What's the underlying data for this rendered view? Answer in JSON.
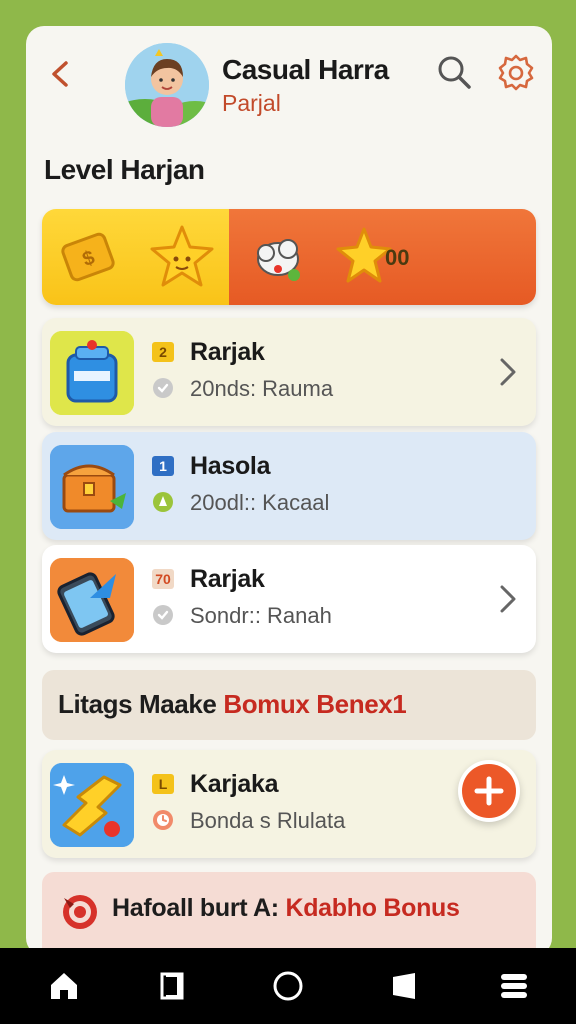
{
  "header": {
    "title": "Casual Harra",
    "subtitle": "Parjal",
    "back_icon": "chevron-left-icon",
    "search_icon": "search-icon",
    "settings_icon": "gear-icon"
  },
  "section_title": "Level Harjan",
  "banner": {
    "score": "00",
    "left_color": "#f9c318",
    "right_color": "#e65a24"
  },
  "items": [
    {
      "badge": "2",
      "title": "Rarjak",
      "meta": "20nds: Rauma",
      "icon": "water-jug-icon",
      "has_chevron": true
    },
    {
      "badge": "1",
      "title": "Hasola",
      "meta": "20odl:: Kacaal",
      "icon": "treasure-chest-icon",
      "has_chevron": false
    },
    {
      "badge": "70",
      "title": "Rarjak",
      "meta": "Sondr:: Ranah",
      "icon": "tablet-icon",
      "has_chevron": true
    },
    {
      "badge": "L",
      "title": "Karjaka",
      "meta": "Bonda s Rlulata",
      "icon": "puzzle-bolt-icon",
      "has_chevron": false
    }
  ],
  "promo": {
    "text": "Litags Maake",
    "accent": "Bomux Benex1"
  },
  "bonus": {
    "text": "Hafoall burt A:",
    "accent": "Kdabho Bonus"
  },
  "fab_icon": "plus-icon",
  "nav": [
    "home-icon",
    "recents-icon",
    "circle-home-icon",
    "back-icon",
    "menu-icon"
  ],
  "colors": {
    "accent": "#ec5828",
    "background": "#8fb84a",
    "card": "#f7f6f1"
  }
}
